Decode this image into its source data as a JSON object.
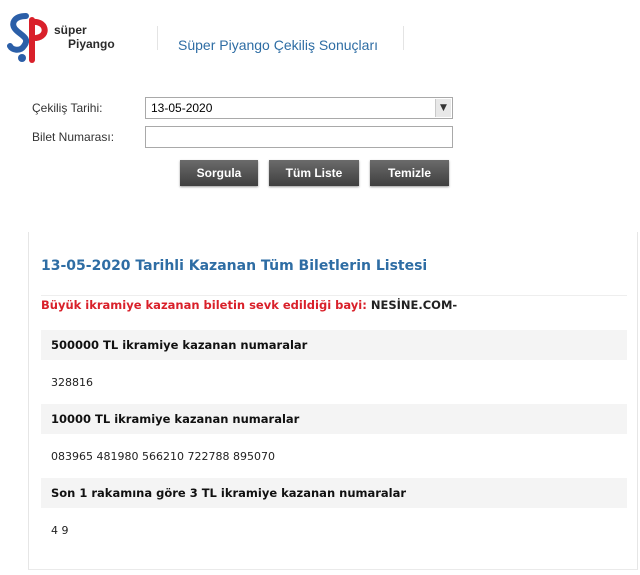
{
  "header": {
    "logo_line1": "süper",
    "logo_line2": "Piyango",
    "title": "Süper Piyango Çekiliş Sonuçları"
  },
  "form": {
    "date_label": "Çekiliş Tarihi:",
    "date_value": "13-05-2020",
    "ticket_label": "Bilet Numarası:",
    "ticket_value": "",
    "buttons": {
      "query": "Sorgula",
      "all_list": "Tüm Liste",
      "clear": "Temizle"
    }
  },
  "results": {
    "title": "13-05-2020 Tarihli Kazanan Tüm Biletlerin Listesi",
    "dealer_label": "Büyük ikramiye kazanan biletin sevk edildiği bayi:",
    "dealer_value": "NESİNE.COM-",
    "sections": [
      {
        "heading": "500000 TL ikramiye kazanan numaralar",
        "numbers": "328816"
      },
      {
        "heading": "10000 TL ikramiye kazanan numaralar",
        "numbers": "083965 481980 566210 722788 895070"
      },
      {
        "heading": "Son 1 rakamına göre 3 TL ikramiye kazanan numaralar",
        "numbers": "4 9"
      }
    ]
  },
  "icons": {
    "logo": "super-piyango-logo-icon",
    "dropdown": "chevron-down-icon"
  },
  "colors": {
    "title_blue": "#2e6da4",
    "dealer_red": "#d9202a",
    "button_dark": "#4a4a4a",
    "logo_blue": "#2b5fa8",
    "logo_red": "#d9202a"
  }
}
